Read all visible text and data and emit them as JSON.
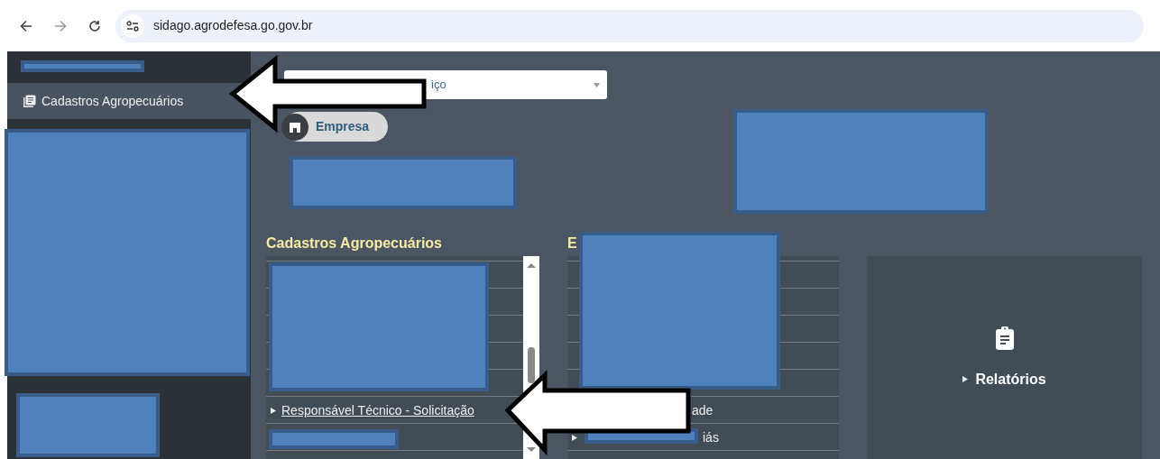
{
  "browser": {
    "url": "sidago.agrodefesa.go.gov.br"
  },
  "sidebar": {
    "items": [
      {
        "label": "Cadastros Agropecuários",
        "selected": true
      }
    ]
  },
  "search_select": {
    "value": "iço"
  },
  "shortcuts": [
    {
      "label": "Empresa"
    }
  ],
  "sections": [
    {
      "title": "Cadastros Agropecuários",
      "scrollbar": true,
      "items": [
        {
          "label": "Responsável Técnico - Solicitação",
          "underlined": true,
          "bullet": true
        }
      ]
    },
    {
      "title": "E",
      "scrollbar": false,
      "items": [
        {
          "label": "ade",
          "underlined": false,
          "bullet": false
        },
        {
          "label": "iás",
          "underlined": false,
          "bullet": true
        }
      ]
    }
  ],
  "reports_tile": {
    "label": "Relatórios"
  }
}
